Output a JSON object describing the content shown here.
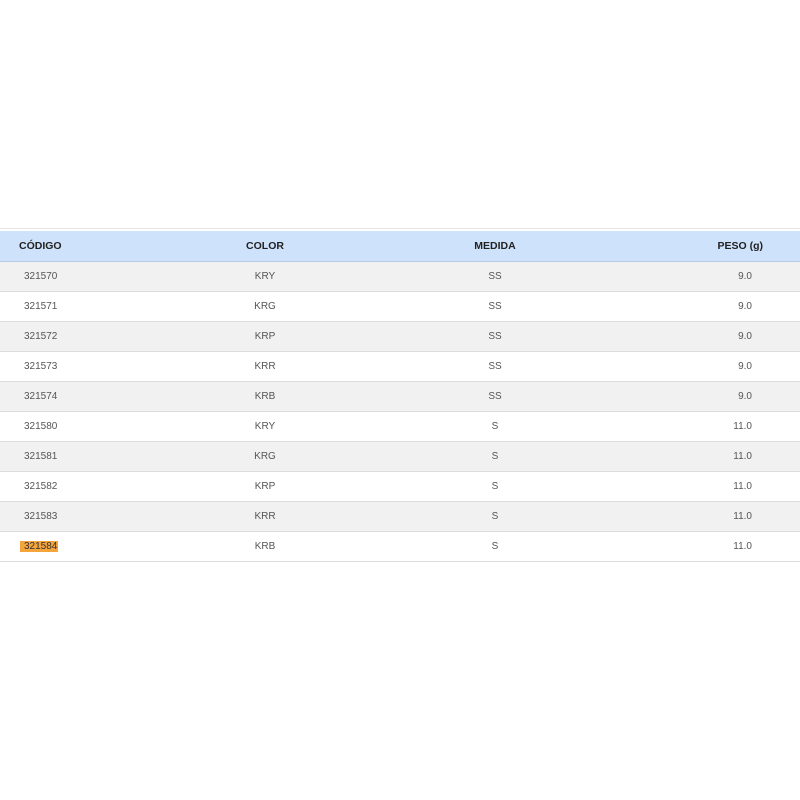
{
  "table": {
    "headers": {
      "codigo": "CÓDIGO",
      "color": "COLOR",
      "medida": "MEDIDA",
      "peso": "PESO (g)"
    },
    "rows": [
      {
        "codigo": "321570",
        "color": "KRY",
        "medida": "SS",
        "peso": "9.0"
      },
      {
        "codigo": "321571",
        "color": "KRG",
        "medida": "SS",
        "peso": "9.0"
      },
      {
        "codigo": "321572",
        "color": "KRP",
        "medida": "SS",
        "peso": "9.0"
      },
      {
        "codigo": "321573",
        "color": "KRR",
        "medida": "SS",
        "peso": "9.0"
      },
      {
        "codigo": "321574",
        "color": "KRB",
        "medida": "SS",
        "peso": "9.0"
      },
      {
        "codigo": "321580",
        "color": "KRY",
        "medida": "S",
        "peso": "11.0"
      },
      {
        "codigo": "321581",
        "color": "KRG",
        "medida": "S",
        "peso": "11.0"
      },
      {
        "codigo": "321582",
        "color": "KRP",
        "medida": "S",
        "peso": "11.0"
      },
      {
        "codigo": "321583",
        "color": "KRR",
        "medida": "S",
        "peso": "11.0"
      },
      {
        "codigo": "321584",
        "color": "KRB",
        "medida": "S",
        "peso": "11.0"
      }
    ],
    "highlighted_codigo": "321584",
    "colors": {
      "header_bg": "#cfe2fb",
      "stripe_bg": "#f1f1f1",
      "highlight": "#f6a43c"
    }
  }
}
